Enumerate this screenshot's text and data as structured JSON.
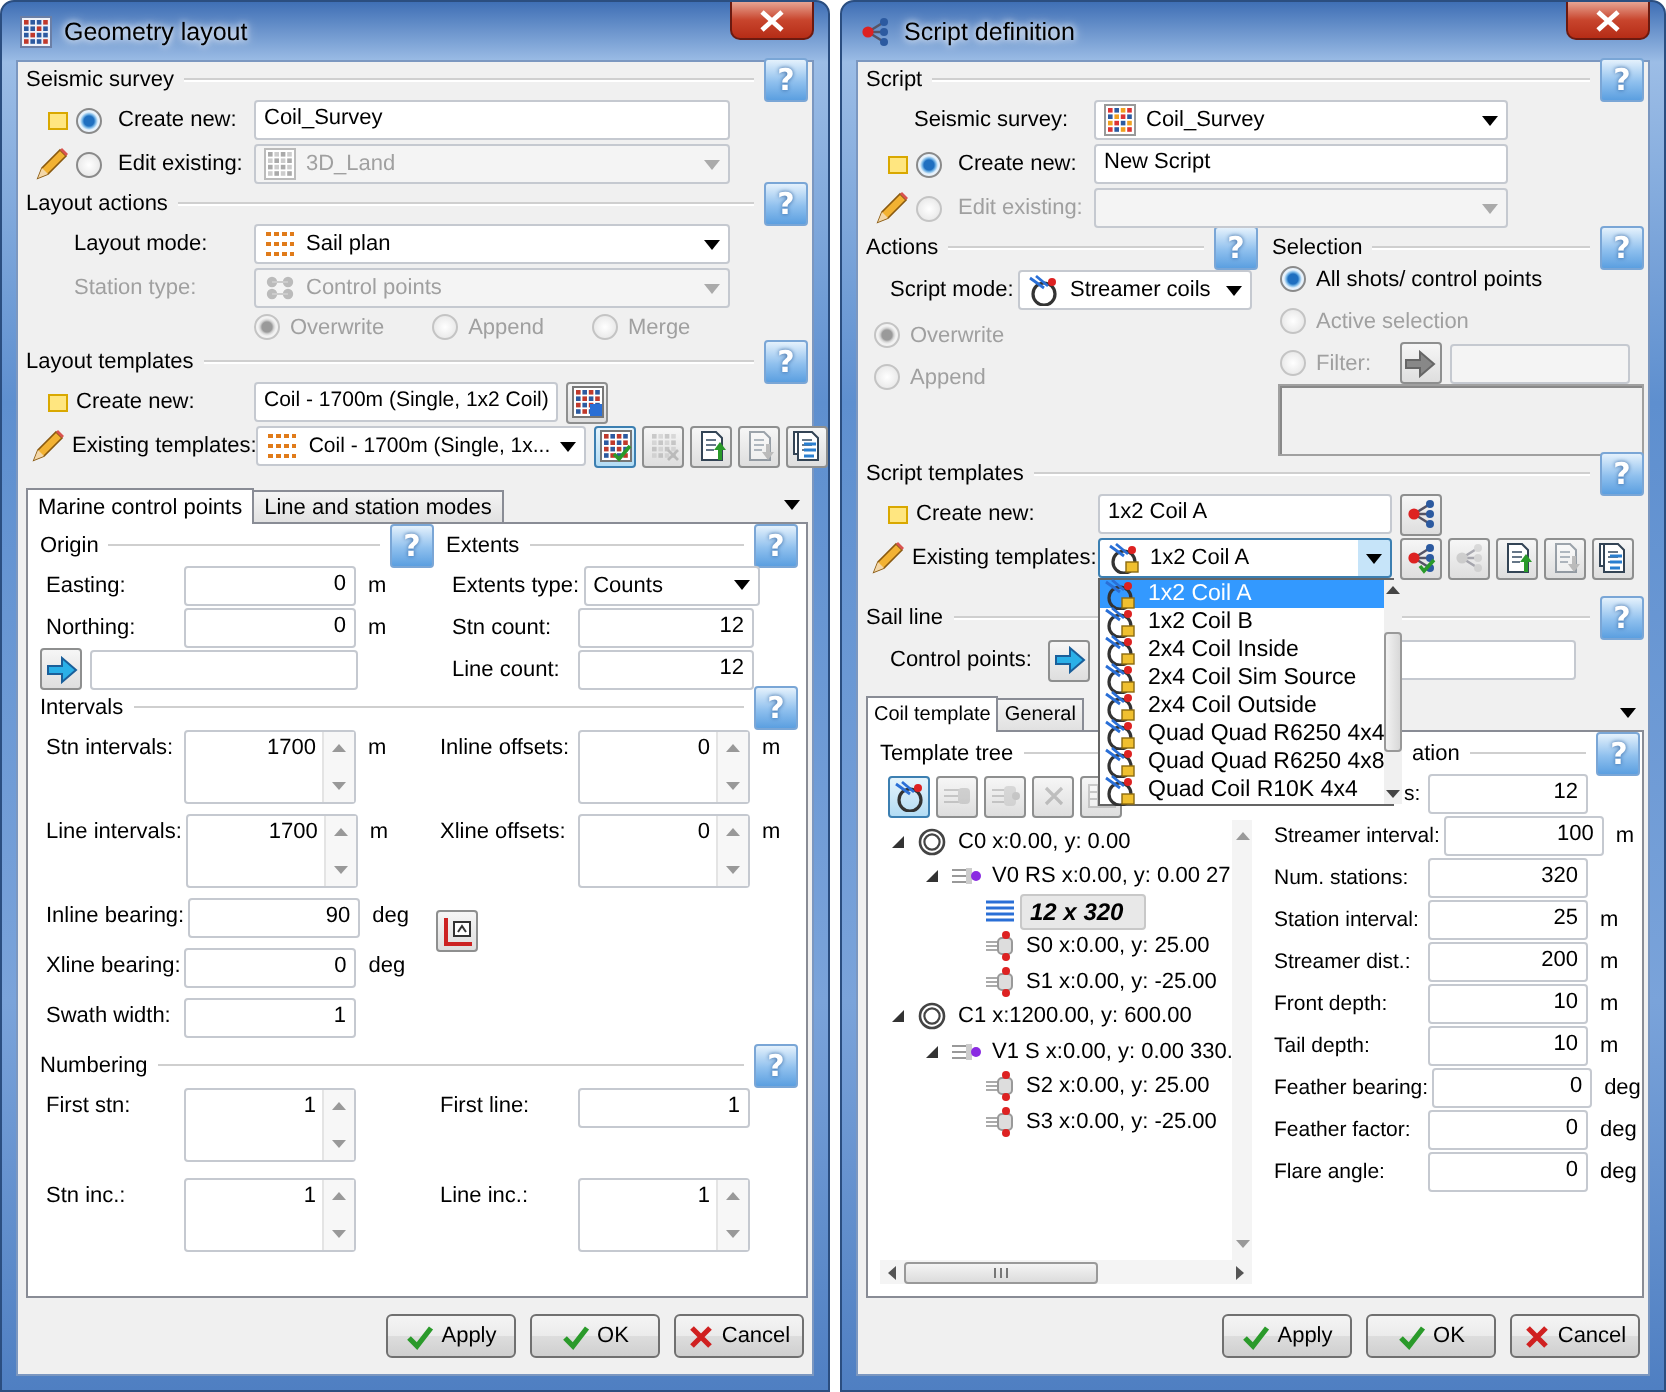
{
  "geometry_window": {
    "title": "Geometry layout",
    "seismic_survey": {
      "title": "Seismic survey",
      "help": "?",
      "create_new": {
        "label": "Create new:",
        "selected": true,
        "value": "Coil_Survey"
      },
      "edit_existing": {
        "label": "Edit existing:",
        "selected": false,
        "disabled": false,
        "field_disabled": true,
        "value": "3D_Land"
      }
    },
    "layout_actions": {
      "title": "Layout actions",
      "help": "?",
      "layout_mode": {
        "label": "Layout mode:",
        "value": "Sail plan",
        "disabled": false
      },
      "station_type": {
        "label": "Station type:",
        "value": "Control points",
        "disabled": true
      },
      "modes": [
        {
          "label": "Overwrite",
          "selected": true,
          "disabled": true
        },
        {
          "label": "Append",
          "selected": false,
          "disabled": true
        },
        {
          "label": "Merge",
          "selected": false,
          "disabled": true
        }
      ]
    },
    "layout_templates": {
      "title": "Layout templates",
      "help": "?",
      "create_new": {
        "label": "Create new:",
        "value": "Coil - 1700m (Single, 1x2 Coil)"
      },
      "existing": {
        "label": "Existing templates:",
        "value": "Coil - 1700m (Single, 1x...",
        "expanded": false,
        "tools": [
          {
            "pressed": true,
            "disabled": false
          },
          {
            "pressed": false,
            "disabled": true
          },
          {
            "pressed": false,
            "disabled": false
          },
          {
            "pressed": false,
            "disabled": true
          },
          {
            "pressed": false,
            "disabled": false
          }
        ]
      }
    },
    "tabs": [
      {
        "label": "Marine control points",
        "selected": true
      },
      {
        "label": "Line and station modes",
        "selected": false
      }
    ],
    "origin": {
      "title": "Origin",
      "help": "?",
      "fields": [
        {
          "label": "Easting:",
          "value": "0",
          "unit": "m"
        },
        {
          "label": "Northing:",
          "value": "0",
          "unit": "m"
        }
      ]
    },
    "extents": {
      "title": "Extents",
      "help": "?",
      "type": {
        "label": "Extents type:",
        "value": "Counts"
      },
      "fields": [
        {
          "label": "Stn count:",
          "value": "12"
        },
        {
          "label": "Line count:",
          "value": "12"
        }
      ]
    },
    "intervals": {
      "title": "Intervals",
      "help": "?",
      "left": [
        {
          "label": "Stn intervals:",
          "value": "1700",
          "unit": "m",
          "kind": "spin"
        },
        {
          "label": "Line intervals:",
          "value": "1700",
          "unit": "m",
          "kind": "spin"
        },
        {
          "label": "Inline bearing:",
          "value": "90",
          "unit": "deg",
          "kind": "text"
        },
        {
          "label": "Xline bearing:",
          "value": "0",
          "unit": "deg",
          "kind": "text"
        },
        {
          "label": "Swath width:",
          "value": "1",
          "kind": "text"
        }
      ],
      "right": [
        {
          "label": "Inline offsets:",
          "value": "0",
          "unit": "m",
          "kind": "spin"
        },
        {
          "label": "Xline offsets:",
          "value": "0",
          "unit": "m",
          "kind": "spin"
        }
      ]
    },
    "numbering": {
      "title": "Numbering",
      "help": "?",
      "left": [
        {
          "label": "First stn:",
          "value": "1",
          "kind": "spin"
        },
        {
          "label": "Stn inc.:",
          "value": "1",
          "kind": "spin"
        }
      ],
      "right": [
        {
          "label": "First line:",
          "value": "1",
          "kind": "text"
        },
        {
          "label": "Line inc.:",
          "value": "1",
          "kind": "spin"
        }
      ]
    },
    "buttons": [
      {
        "label": "Apply",
        "kind": "apply"
      },
      {
        "label": "OK",
        "kind": "ok"
      },
      {
        "label": "Cancel",
        "kind": "cancel"
      }
    ]
  },
  "script_window": {
    "title": "Script definition",
    "script": {
      "title": "Script",
      "help": "?",
      "survey": {
        "label": "Seismic survey:",
        "value": "Coil_Survey"
      },
      "create_new": {
        "label": "Create new:",
        "selected": true,
        "value": "New Script"
      },
      "edit_existing": {
        "label": "Edit existing:",
        "selected": false,
        "disabled": true,
        "field_disabled": true
      }
    },
    "actions": {
      "title": "Actions",
      "help": "?",
      "script_mode": {
        "label": "Script mode:",
        "value": "Streamer coils"
      },
      "options": [
        {
          "label": "Overwrite",
          "selected": true,
          "disabled": true
        },
        {
          "label": "Append",
          "selected": false,
          "disabled": true
        }
      ]
    },
    "selection": {
      "title": "Selection",
      "help": "?",
      "options": [
        {
          "label": "All shots/ control points",
          "selected": true,
          "disabled": false
        },
        {
          "label": "Active selection",
          "selected": false,
          "disabled": true
        },
        {
          "label": "Filter:",
          "selected": false,
          "disabled": true
        }
      ]
    },
    "script_templates": {
      "title": "Script templates",
      "help": "?",
      "create_new": {
        "label": "Create new:",
        "value": "1x2 Coil A"
      },
      "existing": {
        "label": "Existing templates:",
        "value": "1x2 Coil A",
        "expanded": true,
        "tools": [
          {
            "pressed": false,
            "disabled": false
          },
          {
            "pressed": false,
            "disabled": true
          },
          {
            "pressed": false,
            "disabled": false
          },
          {
            "pressed": false,
            "disabled": true
          },
          {
            "pressed": false,
            "disabled": false
          }
        ],
        "options": [
          {
            "label": "1x2 Coil A",
            "selected": true
          },
          {
            "label": "1x2 Coil B",
            "selected": false
          },
          {
            "label": "2x4 Coil Inside",
            "selected": false
          },
          {
            "label": "2x4 Coil Sim Source",
            "selected": false
          },
          {
            "label": "2x4 Coil Outside",
            "selected": false
          },
          {
            "label": "Quad Quad R6250 4x4",
            "selected": false
          },
          {
            "label": "Quad Quad R6250 4x8",
            "selected": false
          },
          {
            "label": "Quad Coil R10K 4x4",
            "selected": false
          }
        ]
      }
    },
    "sail_line": {
      "title": "Sail line",
      "help": "?",
      "control_points": {
        "label": "Control points:"
      }
    },
    "tabs": [
      {
        "label": "Coil template",
        "selected": true
      },
      {
        "label": "General",
        "selected": false
      }
    ],
    "template_tree": {
      "title": "Template tree",
      "tools": [
        {
          "pressed": true,
          "disabled": false
        },
        {
          "pressed": false,
          "disabled": true
        },
        {
          "pressed": false,
          "disabled": true
        },
        {
          "pressed": false,
          "disabled": true
        },
        {
          "pressed": false,
          "disabled": true
        }
      ],
      "nodes": [
        {
          "label": "C0 x:0.00, y: 0.00",
          "kind": "coil",
          "expanded": true,
          "selected": false,
          "children": [
            {
              "label": "V0 RS x:0.00, y: 0.00 27",
              "kind": "vessel",
              "expanded": true,
              "selected": false,
              "children": [
                {
                  "label": "12 x 320",
                  "kind": "grid",
                  "expanded": false,
                  "selected": true
                },
                {
                  "label": "S0 x:0.00, y: 25.00",
                  "kind": "streamer",
                  "expanded": false,
                  "selected": false
                },
                {
                  "label": "S1 x:0.00, y: -25.00",
                  "kind": "streamer",
                  "expanded": false,
                  "selected": false
                }
              ]
            }
          ]
        },
        {
          "label": "C1 x:1200.00, y: 600.00",
          "kind": "coil",
          "expanded": true,
          "selected": false,
          "children": [
            {
              "label": "V1 S x:0.00, y: 0.00 330.",
              "kind": "vessel",
              "expanded": true,
              "selected": false,
              "children": [
                {
                  "label": "S2 x:0.00, y: 25.00",
                  "kind": "streamer",
                  "expanded": false,
                  "selected": false
                },
                {
                  "label": "S3 x:0.00, y: -25.00",
                  "kind": "streamer",
                  "expanded": false,
                  "selected": false
                }
              ]
            }
          ]
        }
      ]
    },
    "coil_pane": {
      "title": "ation",
      "help": "?",
      "fields": [
        {
          "label": "s:",
          "value": "12"
        },
        {
          "label": "Streamer interval:",
          "value": "100",
          "unit": "m"
        },
        {
          "label": "Num. stations:",
          "value": "320"
        },
        {
          "label": "Station interval:",
          "value": "25",
          "unit": "m"
        },
        {
          "label": "Streamer dist.:",
          "value": "200",
          "unit": "m"
        },
        {
          "label": "Front depth:",
          "value": "10",
          "unit": "m"
        },
        {
          "label": "Tail depth:",
          "value": "10",
          "unit": "m"
        },
        {
          "label": "Feather bearing:",
          "value": "0",
          "unit": "deg"
        },
        {
          "label": "Feather factor:",
          "value": "0",
          "unit": "deg"
        },
        {
          "label": "Flare angle:",
          "value": "0",
          "unit": "deg"
        }
      ]
    },
    "buttons": [
      {
        "label": "Apply",
        "kind": "apply"
      },
      {
        "label": "OK",
        "kind": "ok"
      },
      {
        "label": "Cancel",
        "kind": "cancel"
      }
    ]
  }
}
